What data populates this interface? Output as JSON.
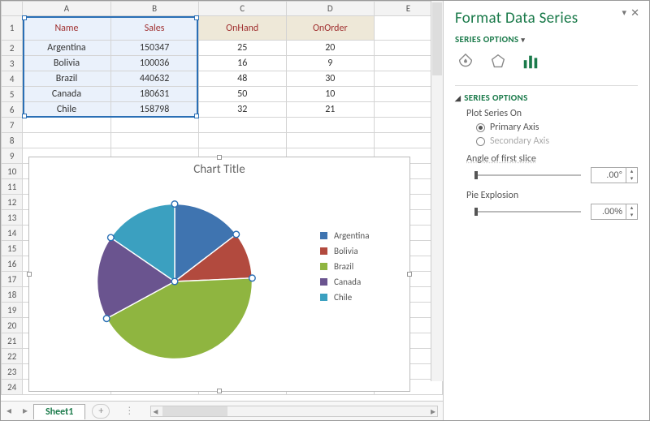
{
  "columns": [
    "A",
    "B",
    "C",
    "D",
    "E"
  ],
  "row_count_visible": 24,
  "headers": {
    "A": "Name",
    "B": "Sales",
    "C": "OnHand",
    "D": "OnOrder"
  },
  "rows": [
    {
      "A": "Argentina",
      "B": "150347",
      "C": "25",
      "D": "20"
    },
    {
      "A": "Bolivia",
      "B": "100036",
      "C": "16",
      "D": "9"
    },
    {
      "A": "Brazil",
      "B": "440632",
      "C": "48",
      "D": "30"
    },
    {
      "A": "Canada",
      "B": "180631",
      "C": "50",
      "D": "10"
    },
    {
      "A": "Chile",
      "B": "158798",
      "C": "32",
      "D": "21"
    }
  ],
  "selection": {
    "range": "A1:B6",
    "active_col": "B"
  },
  "chart": {
    "title": "Chart Title",
    "legend": [
      "Argentina",
      "Bolivia",
      "Brazil",
      "Canada",
      "Chile"
    ],
    "colors": [
      "#3f74b0",
      "#b24a3e",
      "#8fb540",
      "#6a548f",
      "#3ba0c0"
    ]
  },
  "chart_data": {
    "type": "pie",
    "title": "Chart Title",
    "series_name": "Sales",
    "categories": [
      "Argentina",
      "Bolivia",
      "Brazil",
      "Canada",
      "Chile"
    ],
    "values": [
      150347,
      100036,
      440632,
      180631,
      158798
    ],
    "angle_first_slice_deg": 0,
    "explosion_pct": 0
  },
  "pane": {
    "title": "Format Data Series",
    "subhead": "SERIES OPTIONS",
    "section": "SERIES OPTIONS",
    "plot_label": "Plot Series On",
    "radio_primary": "Primary Axis",
    "radio_secondary": "Secondary Axis",
    "angle_label": "Angle of first slice",
    "angle_value": ".00°",
    "explosion_label": "Pie Explosion",
    "explosion_value": ".00%"
  },
  "sheet_tab": "Sheet1"
}
